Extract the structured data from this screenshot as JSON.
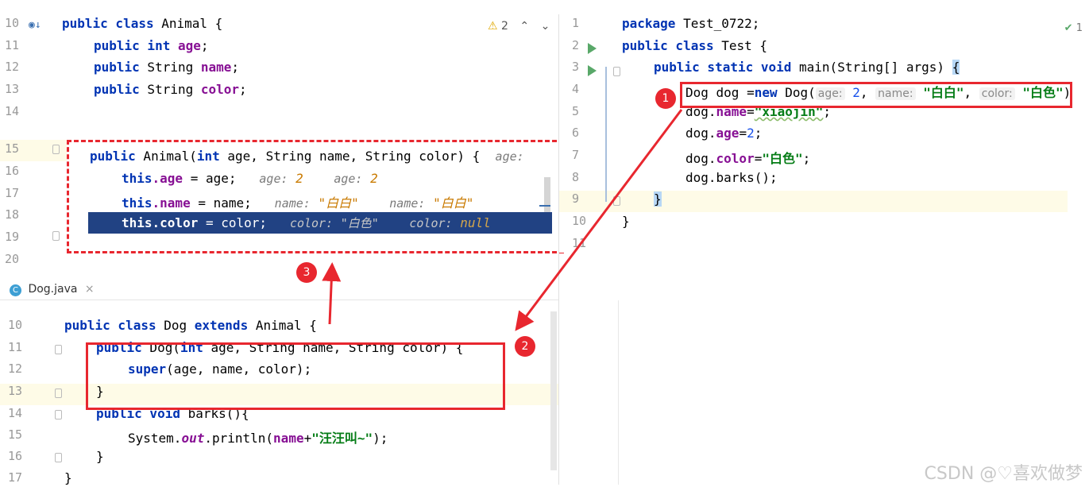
{
  "top_left": {
    "warning_count": "2",
    "lines": [
      {
        "n": "10"
      },
      {
        "n": "11"
      },
      {
        "n": "12"
      },
      {
        "n": "13"
      },
      {
        "n": "14"
      },
      {
        "n": "15"
      },
      {
        "n": "16"
      },
      {
        "n": "17"
      },
      {
        "n": "18"
      },
      {
        "n": "19"
      },
      {
        "n": "20"
      }
    ],
    "code": {
      "l10_a": "public class",
      "l10_b": " Animal {",
      "l11_a": "public int",
      "l11_b": "age",
      "l11_c": ";",
      "l12_a": "public",
      "l12_b": " String ",
      "l12_c": "name",
      "l12_d": ";",
      "l13_a": "public",
      "l13_b": " String ",
      "l13_c": "color",
      "l13_d": ";"
    }
  },
  "popup": {
    "l1_a": "public",
    "l1_b": " Animal(",
    "l1_c": "int",
    "l1_d": " age, String name, String color) {",
    "l1_hint": "age:",
    "l2_a": "this",
    "l2_b": ".age",
    "l2_c": " = age;",
    "l2_h1k": "age:",
    "l2_h1v": "2",
    "l2_h2k": "age:",
    "l2_h2v": "2",
    "l3_a": "this",
    "l3_b": ".name",
    "l3_c": " = name;",
    "l3_h1k": "name:",
    "l3_h1v": "\"白白\"",
    "l3_h2k": "name:",
    "l3_h2v": "\"白白\"",
    "l4_a": "this",
    "l4_b": ".color",
    "l4_c": " = color;",
    "l4_h1k": "color:",
    "l4_h1v": "\"白色\"",
    "l4_h2k": "color:",
    "l4_h2v": "null"
  },
  "bottom_left": {
    "tab_label": "Dog.java",
    "tab_icon": "C",
    "lines": [
      {
        "n": "10"
      },
      {
        "n": "11"
      },
      {
        "n": "12"
      },
      {
        "n": "13"
      },
      {
        "n": "14"
      },
      {
        "n": "15"
      },
      {
        "n": "16"
      },
      {
        "n": "17"
      }
    ],
    "l10_a": "public class",
    "l10_b": " Dog ",
    "l10_c": "extends",
    "l10_d": " Animal {",
    "l11_a": "public",
    "l11_b": " Dog(",
    "l11_c": "int",
    "l11_d": " age, String name, String color) {",
    "l12_a": "super",
    "l12_b": "(age, name, color);",
    "l13_a": "}",
    "l14_a": "public void",
    "l14_b": " barks(){",
    "l15_a": "System.",
    "l15_b": "out",
    "l15_c": ".println(",
    "l15_d": "name",
    "l15_e": "+",
    "l15_f": "\"汪汪叫~\"",
    "l15_g": ");",
    "l16_a": "}",
    "l17_a": "}"
  },
  "right": {
    "check_count": "1",
    "lines": [
      {
        "n": "1"
      },
      {
        "n": "2"
      },
      {
        "n": "3"
      },
      {
        "n": "4"
      },
      {
        "n": "5"
      },
      {
        "n": "6"
      },
      {
        "n": "7"
      },
      {
        "n": "8"
      },
      {
        "n": "9"
      },
      {
        "n": "10"
      },
      {
        "n": "11"
      }
    ],
    "l1_a": "package",
    "l1_b": " Test_0722;",
    "l2_a": "public class",
    "l2_b": " Test {",
    "l3_a": "public static void",
    "l3_b": " main(String[] args) ",
    "l3_c": "{",
    "l4_a": "Dog dog =",
    "l4_b": "new",
    "l4_c": " Dog(",
    "l4_h1": "age:",
    "l4_v1": "2",
    "l4_sep1": ",",
    "l4_h2": "name:",
    "l4_v2": "\"白白\"",
    "l4_sep2": ",",
    "l4_h3": "color:",
    "l4_v3": "\"白色\"",
    "l4_end": ")",
    "l5_a": "dog.",
    "l5_b": "name",
    "l5_c": "=",
    "l5_d": "\"xiaojin\"",
    "l5_e": ";",
    "l6_a": "dog.",
    "l6_b": "age",
    "l6_c": "=",
    "l6_d": "2",
    "l6_e": ";",
    "l7_a": "dog.",
    "l7_b": "color",
    "l7_c": "=",
    "l7_d": "\"白色\"",
    "l7_e": ";",
    "l8_a": "dog.barks();",
    "l9_a": "}",
    "l10_a": "}"
  },
  "annotations": {
    "badge1": "1",
    "badge2": "2",
    "badge3": "3",
    "accent": "#e8272f"
  },
  "watermark": "CSDN @♡喜欢做梦"
}
